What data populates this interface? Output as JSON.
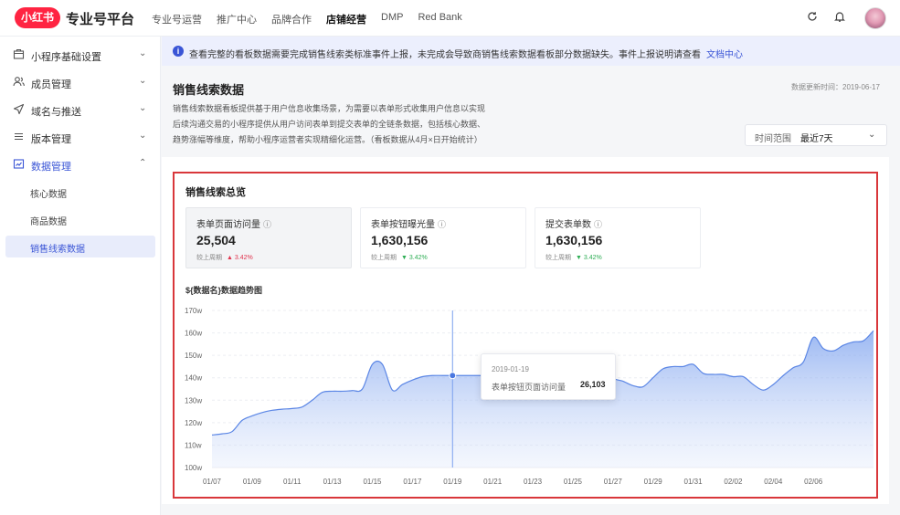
{
  "header": {
    "logo_text": "小红书",
    "platform_title": "专业号平台",
    "nav": [
      {
        "label": "专业号运营",
        "active": false
      },
      {
        "label": "推广中心",
        "active": false
      },
      {
        "label": "品牌合作",
        "active": false
      },
      {
        "label": "店铺经营",
        "active": true
      },
      {
        "label": "DMP",
        "active": false
      },
      {
        "label": "Red Bank",
        "active": false
      }
    ],
    "icons": [
      "refresh-icon",
      "bell-icon",
      "avatar"
    ]
  },
  "sidebar": {
    "items": [
      {
        "label": "小程序基础设置",
        "icon": "store-icon",
        "expanded": false
      },
      {
        "label": "成员管理",
        "icon": "users-icon",
        "expanded": false
      },
      {
        "label": "域名与推送",
        "icon": "send-icon",
        "expanded": false
      },
      {
        "label": "版本管理",
        "icon": "list-icon",
        "expanded": false
      },
      {
        "label": "数据管理",
        "icon": "chart-icon",
        "expanded": true
      }
    ],
    "sub_items": [
      {
        "label": "核心数据",
        "selected": false
      },
      {
        "label": "商品数据",
        "selected": false
      },
      {
        "label": "销售线索数据",
        "selected": true
      }
    ]
  },
  "notice": {
    "text": "查看完整的看板数据需要完成销售线索类标准事件上报，未完成会导致商销售线索数据看板部分数据缺失。事件上报说明请查看",
    "link": "文档中心"
  },
  "page": {
    "title": "销售线索数据",
    "update_time": "数据更新时间：2019-06-17",
    "description_lines": [
      "销售线索数据看板提供基于用户信息收集场景，为需要以表单形式收集用户信息以实现",
      "后续沟通交易的小程序提供从用户访问表单到提交表单的全链条数据，包括核心数据、",
      "趋势涨幅等维度，帮助小程序运营者实现精细化运营。（看板数据从4月×日开始统计）"
    ],
    "time_range_label": "时间范围",
    "time_range_value": "最近7天"
  },
  "overview": {
    "title": "销售线索总览",
    "compare_label": "较上周期",
    "metrics": [
      {
        "label": "表单页面访问量",
        "value": "25,504",
        "delta": "3.42%",
        "direction": "up",
        "selected": true
      },
      {
        "label": "表单按钮曝光量",
        "value": "1,630,156",
        "delta": "3.42%",
        "direction": "down",
        "selected": false
      },
      {
        "label": "提交表单数",
        "value": "1,630,156",
        "delta": "3.42%",
        "direction": "down",
        "selected": false
      }
    ]
  },
  "trend": {
    "title": "${数据名}数据趋势图",
    "tooltip": {
      "date": "2019-01-19",
      "label": "表单按钮页面访问量",
      "value": "26,103"
    }
  },
  "colors": {
    "accent": "#3a55d6",
    "brand": "#ff2442",
    "highlight": "#d9373b",
    "up": "#e0344e",
    "down": "#2fae55",
    "line": "#5b86e5"
  },
  "chart_data": {
    "type": "area",
    "y_ticks": [
      "170w",
      "160w",
      "150w",
      "140w",
      "130w",
      "120w",
      "110w",
      "100w"
    ],
    "x_ticks": [
      "01/07",
      "01/09",
      "01/11",
      "01/13",
      "01/15",
      "01/17",
      "01/19",
      "01/21",
      "01/23",
      "01/25",
      "01/27",
      "01/29",
      "01/31",
      "02/02",
      "02/04",
      "02/06"
    ],
    "ylim": [
      100,
      170
    ],
    "unit": "w",
    "grid": true,
    "highlight_x": "01/19",
    "x": [
      0,
      0.5,
      1,
      1.5,
      2,
      2.5,
      3,
      3.5,
      4,
      4.5,
      5,
      5.5,
      6,
      6.5,
      7,
      7.5,
      8,
      8.5,
      9,
      9.5,
      10,
      10.5,
      11,
      11.5,
      12,
      12.5,
      13,
      13.5,
      14,
      14.5,
      15,
      15.5,
      16,
      16.5,
      17,
      17.5,
      18,
      18.5,
      19,
      19.5,
      20,
      20.5,
      21,
      21.5,
      22,
      22.5,
      23,
      23.5,
      24,
      24.5,
      25,
      25.5,
      26,
      26.5,
      27,
      27.5,
      28,
      28.5,
      29,
      29.5,
      30,
      30.5,
      31,
      31.5,
      32,
      32.5,
      33
    ],
    "values": [
      114.5,
      115,
      116,
      121,
      123,
      124.5,
      125.5,
      126,
      126.3,
      127,
      130,
      133.5,
      134,
      134,
      134.3,
      135,
      146,
      146,
      134.5,
      137,
      139,
      140.5,
      141,
      141,
      141,
      141,
      141,
      141,
      141,
      141,
      141,
      141,
      141,
      141,
      141.5,
      142.5,
      146.5,
      140,
      141.5,
      146,
      140,
      138.5,
      136.5,
      136,
      140,
      144,
      145,
      145,
      146,
      142,
      141.5,
      141.5,
      140.5,
      140.5,
      137,
      134.5,
      137,
      141,
      144.5,
      147,
      158,
      153,
      152,
      154.5,
      156,
      156.5,
      161
    ]
  }
}
